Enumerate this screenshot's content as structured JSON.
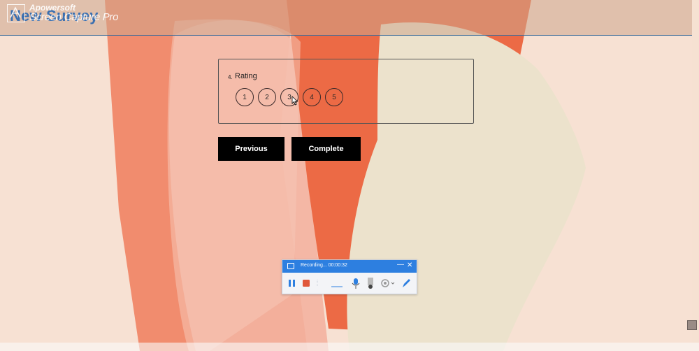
{
  "header": {
    "survey_title": "New Survey"
  },
  "watermark": {
    "line1": "Apowersoft",
    "line2": "Screen Capture Pro"
  },
  "question": {
    "number": "4.",
    "title": "Rating",
    "options": [
      "1",
      "2",
      "3",
      "4",
      "5"
    ]
  },
  "navigation": {
    "previous_label": "Previous",
    "complete_label": "Complete"
  },
  "recorder": {
    "status": "Recording... 00:00:32",
    "minimize_glyph": "—",
    "close_glyph": "✕",
    "tools": [
      "pause-icon",
      "stop-icon",
      "volume-level",
      "microphone-icon",
      "webcam-icon",
      "settings-icon",
      "pen-icon"
    ]
  },
  "colors": {
    "header_title": "#3a6fb0",
    "button_bg": "#000000",
    "recorder_titlebar": "#2d7fe0",
    "stop_button": "#e0573a"
  }
}
